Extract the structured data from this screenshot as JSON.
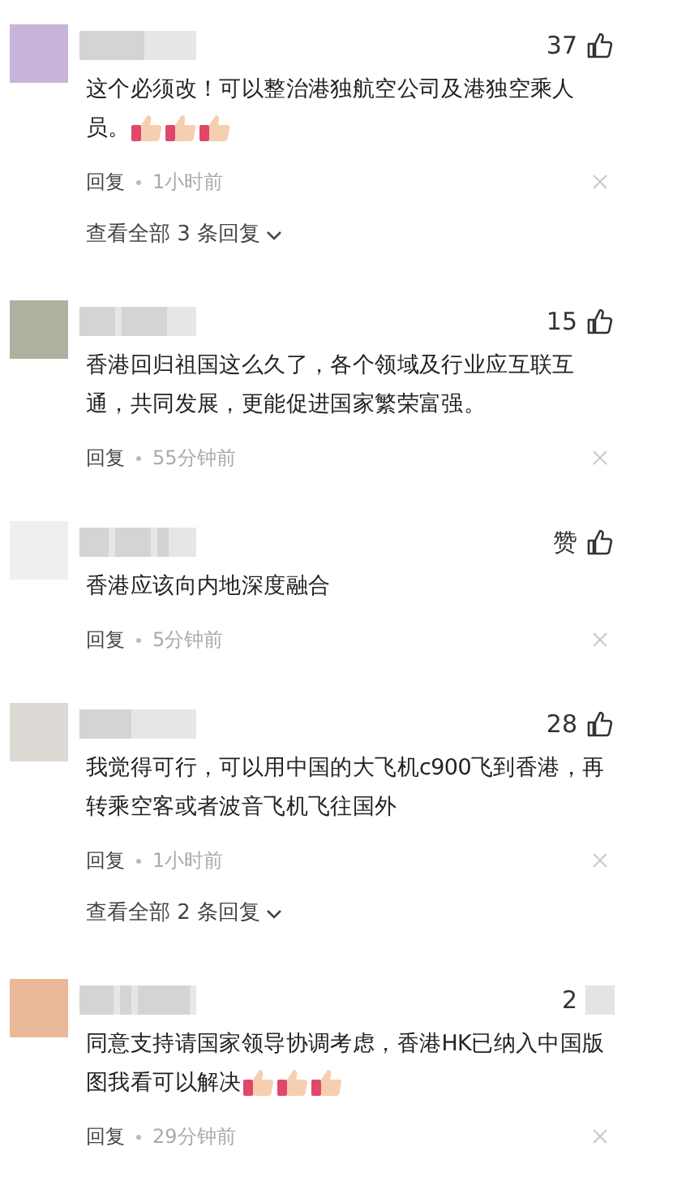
{
  "comments": [
    {
      "color": "#c8b4d8",
      "likes": "37",
      "like_redacted": false,
      "lines": [
        "这个必须改！可以整治港独航空公司及港独空乘人",
        "员。"
      ],
      "emojis": [
        {
          "kind": "thumbs"
        },
        {
          "kind": "thumbs"
        },
        {
          "kind": "thumbs"
        }
      ],
      "reply": "回复",
      "time": "1小时前",
      "replies_link": "查看全部 3 条回复"
    },
    {
      "color": "#aeb0a0",
      "likes": "15",
      "like_redacted": false,
      "lines": [
        "香港回归祖国这么久了，各个领域及行业应互联互",
        "通，共同发展，更能促进国家繁荣富强。"
      ],
      "reply": "回复",
      "time": "55分钟前"
    },
    {
      "color": "#efefef",
      "likes": "赞",
      "like_redacted": false,
      "lines": [
        "香港应该向内地深度融合"
      ],
      "reply": "回复",
      "time": "5分钟前"
    },
    {
      "color": "#dcd8d4",
      "likes": "28",
      "like_redacted": false,
      "lines": [
        "我觉得可行，可以用中国的大飞机c900飞到香港，再",
        "转乘空客或者波音飞机飞往国外"
      ],
      "reply": "回复",
      "time": "1小时前",
      "replies_link": "查看全部 2 条回复"
    },
    {
      "color": "#e8b898",
      "likes": "2",
      "like_redacted": true,
      "lines": [
        "同意支持请国家领导协调考虑，香港HK已纳入中国版",
        "图我看可以解决"
      ],
      "emojis": [
        {
          "kind": "thumbs"
        },
        {
          "kind": "thumbs"
        },
        {
          "kind": "thumbs"
        }
      ],
      "reply": "回复",
      "time": "29分钟前"
    }
  ]
}
